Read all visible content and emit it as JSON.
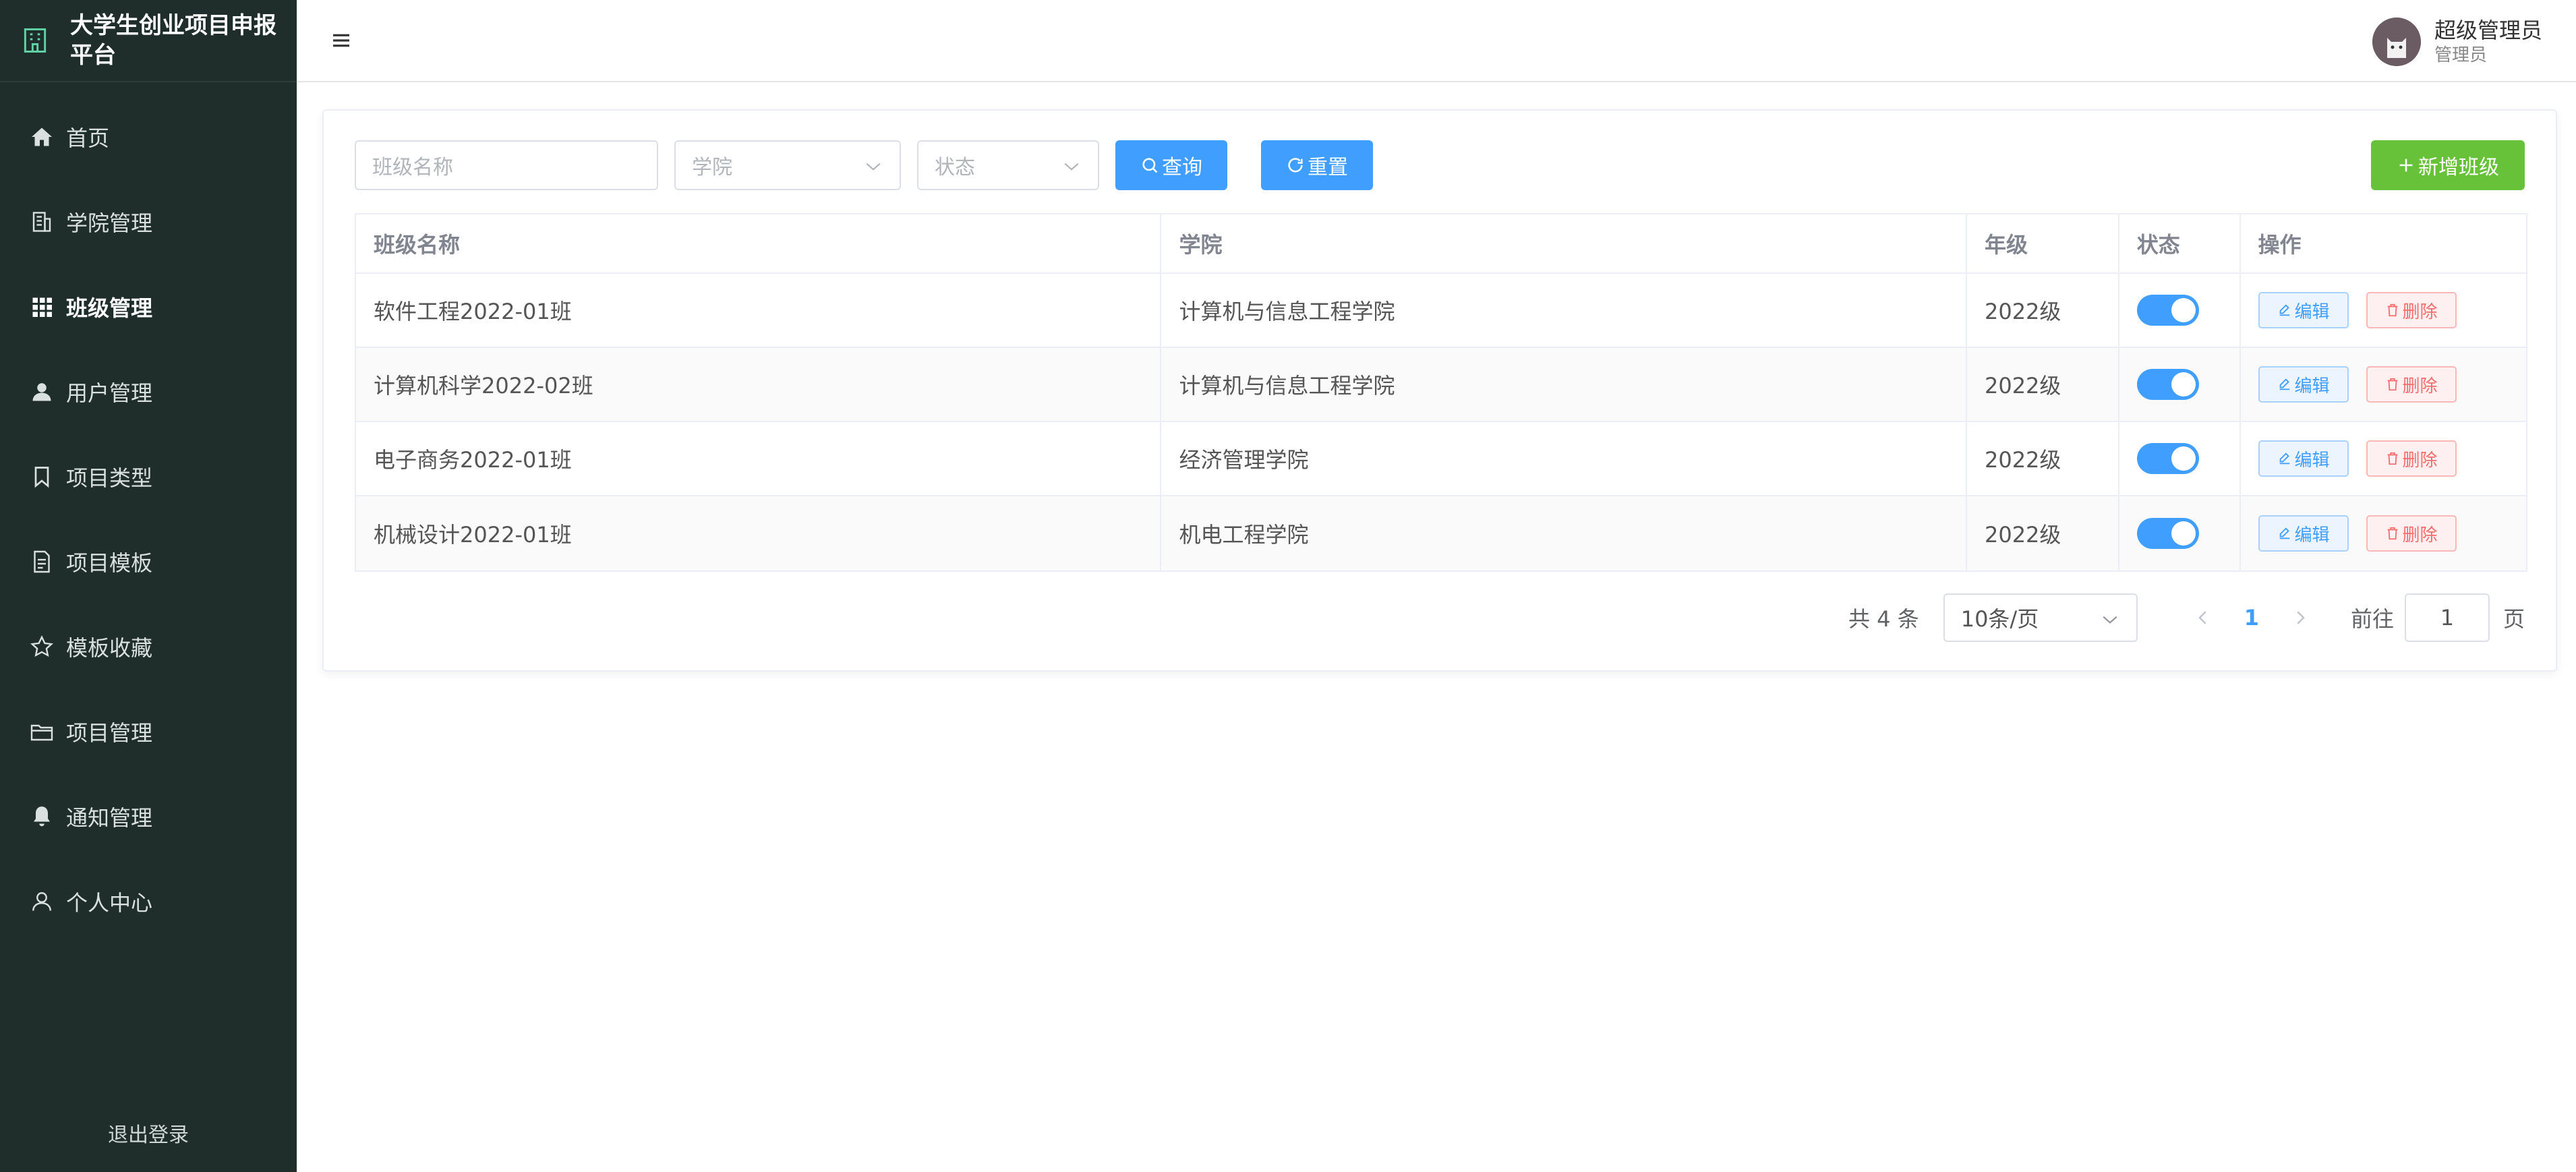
{
  "app": {
    "title": "大学生创业项目申报平台"
  },
  "colors": {
    "sidebar_bg": "#1f2d2b",
    "primary": "#409eff",
    "success": "#67c23a",
    "danger": "#f56c6c"
  },
  "sidebar": {
    "items": [
      {
        "label": "首页",
        "icon": "home-icon"
      },
      {
        "label": "学院管理",
        "icon": "building-icon"
      },
      {
        "label": "班级管理",
        "icon": "grid-icon",
        "active": true
      },
      {
        "label": "用户管理",
        "icon": "user-icon"
      },
      {
        "label": "项目类型",
        "icon": "bookmark-icon"
      },
      {
        "label": "项目模板",
        "icon": "document-icon"
      },
      {
        "label": "模板收藏",
        "icon": "star-icon"
      },
      {
        "label": "项目管理",
        "icon": "folder-icon"
      },
      {
        "label": "通知管理",
        "icon": "bell-icon"
      },
      {
        "label": "个人中心",
        "icon": "person-icon"
      }
    ],
    "logout_label": "退出登录"
  },
  "header": {
    "user_name": "超级管理员",
    "user_role": "管理员"
  },
  "filters": {
    "class_name_placeholder": "班级名称",
    "college_placeholder": "学院",
    "status_placeholder": "状态",
    "query_label": "查询",
    "reset_label": "重置",
    "add_label": "新增班级"
  },
  "table": {
    "columns": [
      "班级名称",
      "学院",
      "年级",
      "状态",
      "操作"
    ],
    "rows": [
      {
        "name": "软件工程2022-01班",
        "college": "计算机与信息工程学院",
        "grade": "2022级",
        "enabled": true
      },
      {
        "name": "计算机科学2022-02班",
        "college": "计算机与信息工程学院",
        "grade": "2022级",
        "enabled": true
      },
      {
        "name": "电子商务2022-01班",
        "college": "经济管理学院",
        "grade": "2022级",
        "enabled": true
      },
      {
        "name": "机械设计2022-01班",
        "college": "机电工程学院",
        "grade": "2022级",
        "enabled": true
      }
    ],
    "edit_label": "编辑",
    "delete_label": "删除"
  },
  "pagination": {
    "total_label": "共 4 条",
    "page_size": "10条/页",
    "current_page": "1",
    "goto_label": "前往",
    "goto_value": "1",
    "page_suffix": "页"
  }
}
